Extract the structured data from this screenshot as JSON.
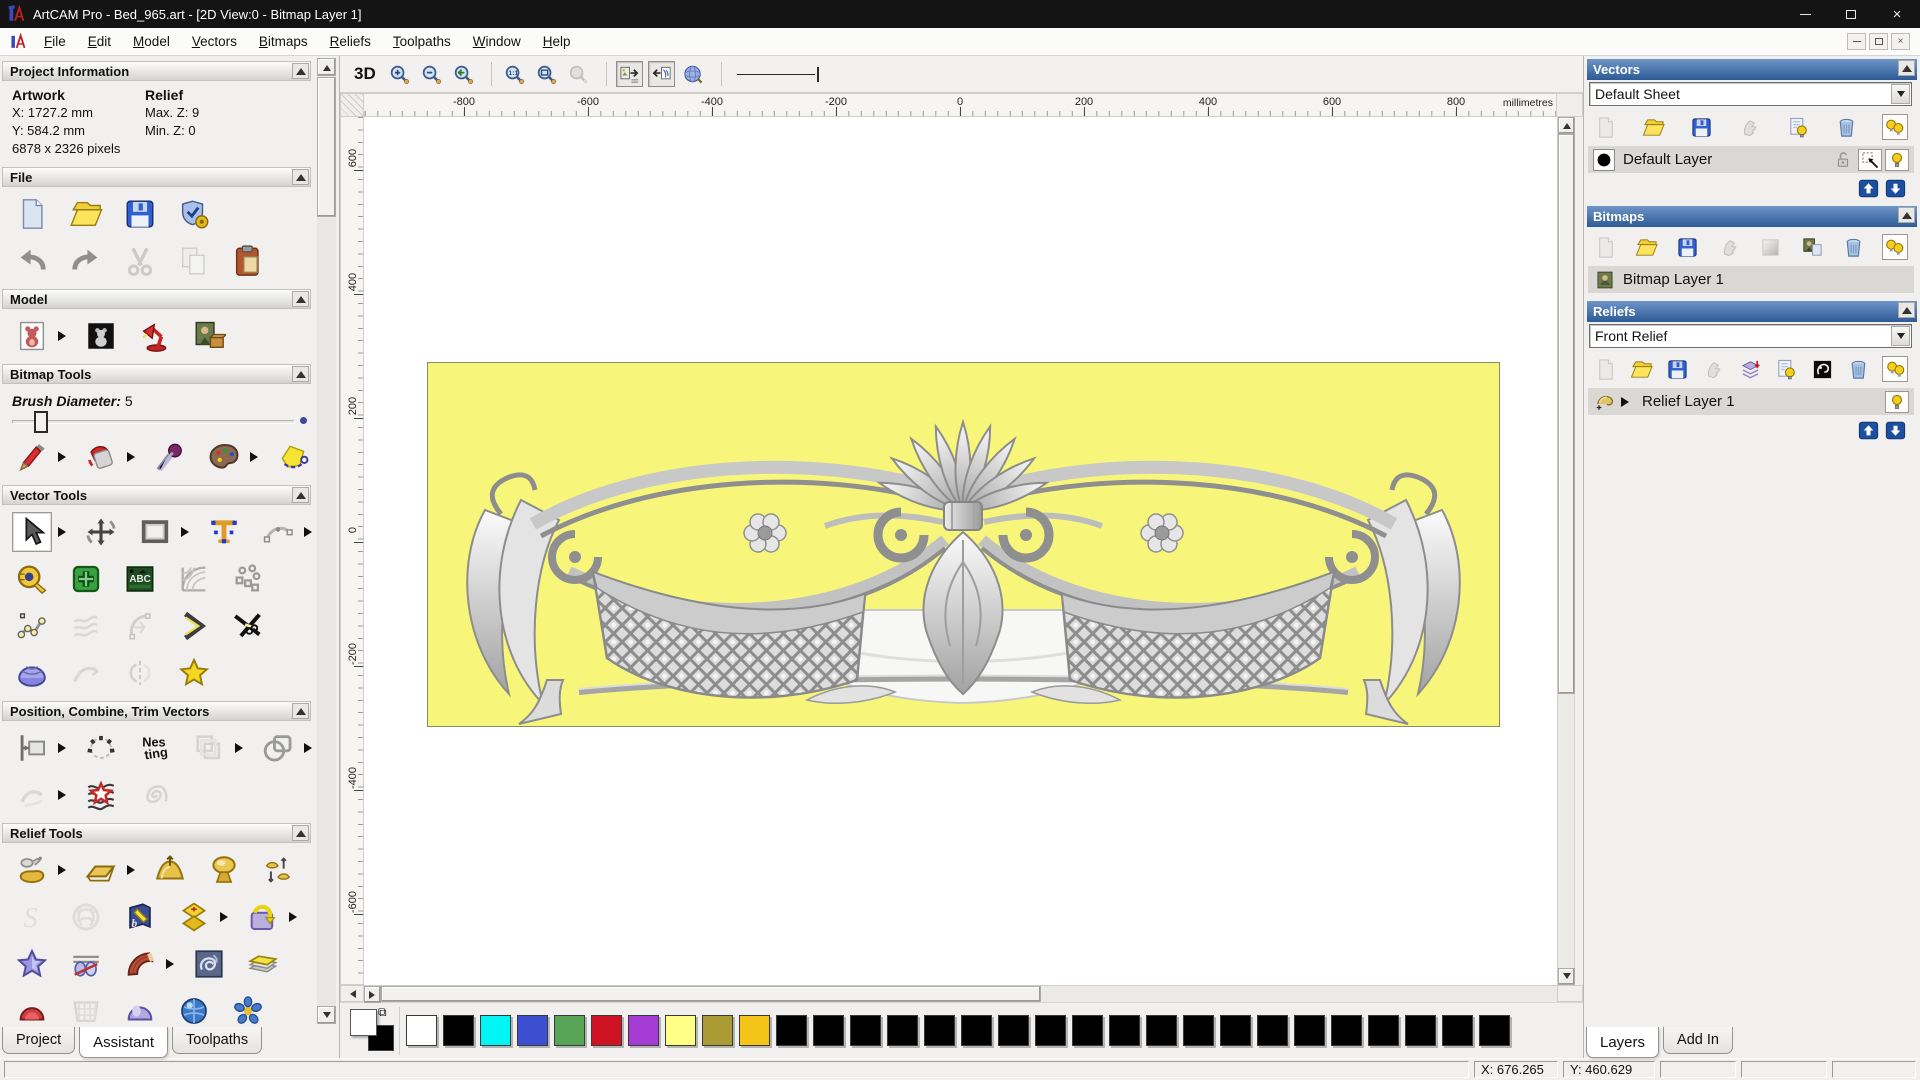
{
  "window": {
    "title": "ArtCAM Pro - Bed_965.art - [2D View:0 - Bitmap Layer 1]"
  },
  "menu": {
    "items": [
      "File",
      "Edit",
      "Model",
      "Vectors",
      "Bitmaps",
      "Reliefs",
      "Toolpaths",
      "Window",
      "Help"
    ]
  },
  "project_information": {
    "title": "Project Information",
    "artwork_heading": "Artwork",
    "artwork_x": "X: 1727.2 mm",
    "artwork_y": "Y: 584.2 mm",
    "artwork_pixels": "6878 x 2326 pixels",
    "relief_heading": "Relief",
    "relief_max": "Max. Z: 9",
    "relief_min": "Min. Z: 0"
  },
  "brush": {
    "label": "Brush Diameter:",
    "value": "5"
  },
  "tool_sections": [
    {
      "title": "File",
      "rows": [
        [
          "new-file",
          "open-folder",
          "save-disk",
          "options-shield"
        ],
        [
          "undo",
          "redo",
          "~cut",
          "~copy",
          "paste"
        ]
      ]
    },
    {
      "title": "Model",
      "rows": [
        [
          "model-teddy",
          ">",
          "greyscale-teddy",
          "lamp-light",
          "texture-image"
        ]
      ]
    },
    {
      "title": "Bitmap Tools",
      "slider": true,
      "rows": [
        [
          "paint-brush",
          ">",
          "flood-fill",
          ">",
          "colour-picker",
          "palette",
          ">",
          "bitmap-to-vector"
        ]
      ]
    },
    {
      "title": "Vector Tools",
      "rows": [
        [
          "*select-cursor",
          ">",
          "transform-vectors",
          "create-rectangle",
          ">",
          "create-text",
          "node-editing",
          ">"
        ],
        [
          "measure-tool",
          "block-copy",
          "text-panel",
          "distort-grid",
          "paste-array"
        ],
        [
          "create-polyline",
          "~free-sketch",
          "~create-arc",
          "chevron-polyline",
          "trim-vectors"
        ],
        [
          "extrude-dome",
          "~fit-curve",
          "~mirror-vectors",
          "create-star"
        ]
      ]
    },
    {
      "title": "Position, Combine, Trim Vectors",
      "rows": [
        [
          "align-vectors",
          ">",
          "text-on-curve",
          "nesting",
          "~combine-vectors",
          ">",
          "weld-vectors",
          ">"
        ],
        [
          "~trim-pieces",
          ">",
          "distort-star",
          "~spiral"
        ]
      ]
    },
    {
      "title": "Relief Tools",
      "rows": [
        [
          "shape-editor",
          ">",
          "add-plane",
          ">",
          "smooth-relief",
          "dome-relief",
          "scale-relief"
        ],
        [
          "~sculpt-s",
          "~weave-relief",
          "emboss-book",
          "shape-diamond",
          ">",
          "wrap-relief",
          ">"
        ],
        [
          "star-relief",
          "two-rail-sweep",
          "fan-relief",
          ">",
          "texture-relief",
          "offset-relief"
        ],
        [
          "angle-relief",
          "~basket-weave",
          "dome-soft",
          "sphere-relief",
          "flower-relief"
        ]
      ]
    }
  ],
  "left_tabs": {
    "items": [
      "Project",
      "Assistant",
      "Toolpaths"
    ],
    "active": "Assistant"
  },
  "toolbar": {
    "label_3d": "3D",
    "items": [
      "zoom-in",
      "zoom-out",
      "zoom-previous",
      "|",
      "zoom-1to1",
      "zoom-fit",
      "~zoom-object",
      "|",
      "^toggle-bitmap",
      "^toggle-vector",
      "sphere-view",
      "|"
    ]
  },
  "ruler": {
    "unit": "millimetres",
    "h_ticks": [
      -800,
      -600,
      -400,
      -200,
      0,
      200,
      400,
      600,
      800
    ],
    "v_ticks": [
      600,
      400,
      200,
      0,
      -200,
      -400,
      -600
    ]
  },
  "vectors_panel": {
    "title": "Vectors",
    "sheet_value": "Default Sheet",
    "tools": [
      "~new-file",
      "open-folder",
      "save-disk",
      "~merge-hand",
      "bulb-doc",
      "trash",
      "^all-bulbs"
    ],
    "layer_name": "Default Layer",
    "layer_color": "#000000",
    "layer_icons": [
      "~lock-open",
      "^snap-arrow",
      "^bulb-on"
    ]
  },
  "bitmaps_panel": {
    "title": "Bitmaps",
    "tools": [
      "~new-file",
      "open-folder",
      "save-disk",
      "~merge-hand",
      "~gradient-square",
      "image-copy",
      "trash",
      "^all-bulbs"
    ],
    "layer_name": "Bitmap Layer 1"
  },
  "reliefs_panel": {
    "title": "Reliefs",
    "combo_value": "Front Relief",
    "tools": [
      "~new-file",
      "open-folder",
      "save-disk",
      "~merge-hand",
      "stack-add",
      "bulb-doc",
      "relief-preview",
      "trash",
      "^all-bulbs"
    ],
    "layer_name": "Relief Layer 1",
    "layer_icons": [
      "^bulb-on"
    ]
  },
  "right_tabs": {
    "items": [
      "Layers",
      "Add In"
    ],
    "active": "Layers"
  },
  "palette": {
    "primary": "#FFFFFF",
    "secondary": "#000000",
    "colors": [
      "#FFFFFF",
      "#000000",
      "#00F5F5",
      "#3B4FD0",
      "#57A557",
      "#D01323",
      "#A43BD4",
      "#FFFF85",
      "#AB9B35",
      "#F4C418",
      "#000000",
      "#000000",
      "#000000",
      "#000000",
      "#000000",
      "#000000",
      "#000000",
      "#000000",
      "#000000",
      "#000000",
      "#000000",
      "#000000",
      "#000000",
      "#000000",
      "#000000",
      "#000000",
      "#000000",
      "#000000",
      "#000000",
      "#000000"
    ]
  },
  "status": {
    "x_label": "X: 676.265",
    "y_label": "Y: 460.629"
  }
}
